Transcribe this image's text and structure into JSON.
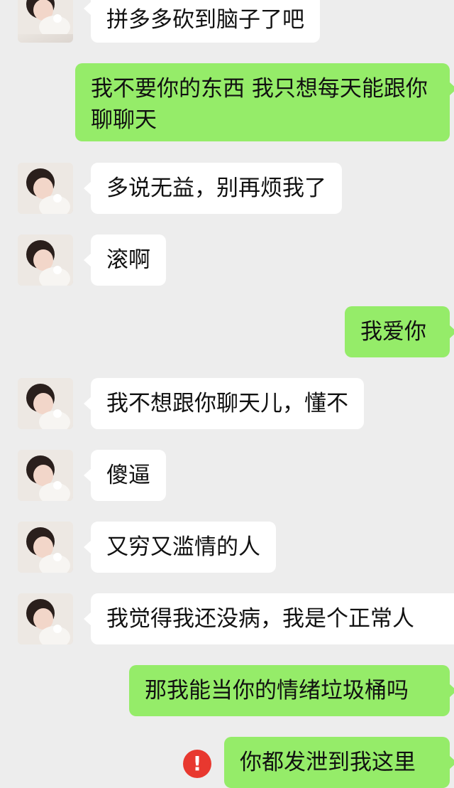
{
  "messages": [
    {
      "side": "in",
      "text": "拼多多砍到脑子了吧"
    },
    {
      "side": "out",
      "text": "我不要你的东西 我只想每天能跟你聊聊天"
    },
    {
      "side": "in",
      "text": "多说无益，别再烦我了"
    },
    {
      "side": "in",
      "text": "滚啊"
    },
    {
      "side": "out",
      "text": "我爱你"
    },
    {
      "side": "in",
      "text": "我不想跟你聊天儿，懂不"
    },
    {
      "side": "in",
      "text": "傻逼"
    },
    {
      "side": "in",
      "text": "又穷又滥情的人"
    },
    {
      "side": "in",
      "text": "我觉得我还没病，我是个正常人"
    },
    {
      "side": "out",
      "text": "那我能当你的情绪垃圾桶吗"
    },
    {
      "side": "out",
      "text": "你都发泄到我这里",
      "status_icon": "!"
    }
  ],
  "icons": {
    "avatar": "avatar",
    "error": "error-icon"
  }
}
